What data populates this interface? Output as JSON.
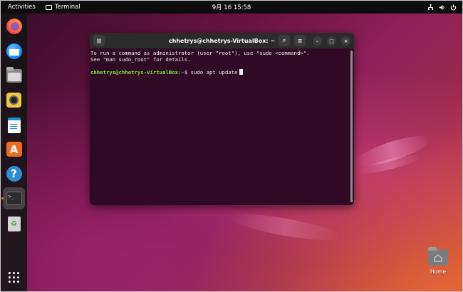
{
  "topbar": {
    "activities": "Activities",
    "app_name": "Terminal",
    "clock": "9月 16  15:58",
    "tray_icons": [
      "network-icon",
      "volume-icon",
      "power-icon"
    ]
  },
  "dock": {
    "items": [
      {
        "name": "firefox",
        "icon": "firefox-icon"
      },
      {
        "name": "thunderbird",
        "icon": "thunderbird-icon"
      },
      {
        "name": "files",
        "icon": "files-icon"
      },
      {
        "name": "rhythmbox",
        "icon": "rhythmbox-icon"
      },
      {
        "name": "libreoffice-writer",
        "icon": "writer-icon"
      },
      {
        "name": "ubuntu-software",
        "icon": "appstore-icon",
        "glyph": "A"
      },
      {
        "name": "help",
        "icon": "help-icon",
        "glyph": "?"
      },
      {
        "name": "terminal",
        "icon": "terminal-icon",
        "glyph": ">_",
        "active": true
      },
      {
        "name": "trash",
        "icon": "trash-icon",
        "glyph": "♻"
      },
      {
        "name": "show-applications",
        "icon": "app-grid-icon"
      }
    ]
  },
  "terminal": {
    "title": "chhetrys@chhetrys-VirtualBox: ~",
    "lines": {
      "l1": "To run a command as administrator (user \"root\"), use \"sudo <command>\".",
      "l2": "See \"man sudo_root\" for details."
    },
    "prompt": {
      "user_host": "chhetrys@chhetrys-VirtualBox",
      "sep": ":",
      "path": "~",
      "symbol": "$ ",
      "command": "sudo apt update"
    },
    "buttons": {
      "new_tab": "⊞",
      "search": "⌕",
      "menu": "≡",
      "minimize": "–",
      "maximize": "□",
      "close": "×"
    }
  },
  "desktop": {
    "home_label": "Home"
  },
  "colors": {
    "terminal_bg": "#300a24",
    "prompt_user": "#8ae234",
    "prompt_path": "#729fcf",
    "accent": "#f07030"
  }
}
